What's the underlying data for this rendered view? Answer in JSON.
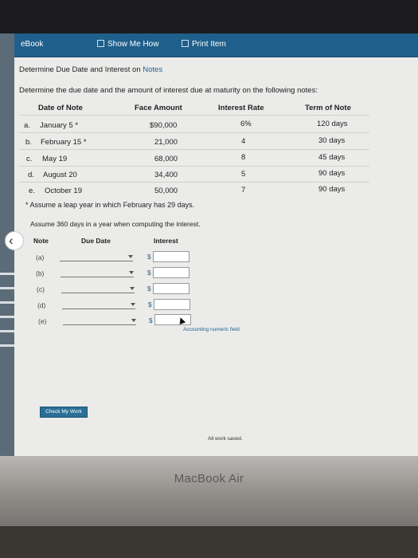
{
  "toolbar": {
    "ebook": "eBook",
    "show_me_how": "Show Me How",
    "print_item": "Print Item"
  },
  "title": {
    "prefix": "Determine Due Date and Interest on ",
    "link": "Notes"
  },
  "instruction": "Determine the due date and the amount of interest due at maturity on the following notes:",
  "notes_table": {
    "headers": [
      "Date of Note",
      "Face Amount",
      "Interest Rate",
      "Term of Note"
    ],
    "rows": [
      {
        "letter": "a.",
        "date": "January 5 *",
        "face": "$90,000",
        "rate": "6%",
        "term": "120 days"
      },
      {
        "letter": "b.",
        "date": "February 15 *",
        "face": "21,000",
        "rate": "4",
        "term": "30 days"
      },
      {
        "letter": "c.",
        "date": "May 19",
        "face": "68,000",
        "rate": "8",
        "term": "45 days"
      },
      {
        "letter": "d.",
        "date": "August 20",
        "face": "34,400",
        "rate": "5",
        "term": "90 days"
      },
      {
        "letter": "e.",
        "date": "October 19",
        "face": "50,000",
        "rate": "7",
        "term": "90 days"
      }
    ]
  },
  "footnote": "* Assume a leap year in which February has 29 days.",
  "assume_text": "Assume 360 days in a year when computing the interest.",
  "answer_table": {
    "headers": [
      "Note",
      "Due Date",
      "Interest"
    ],
    "rows": [
      {
        "label": "(a)",
        "currency": "$",
        "due_date": "",
        "interest": ""
      },
      {
        "label": "(b)",
        "currency": "$",
        "due_date": "",
        "interest": ""
      },
      {
        "label": "(c)",
        "currency": "$",
        "due_date": "",
        "interest": ""
      },
      {
        "label": "(d)",
        "currency": "$",
        "due_date": "",
        "interest": ""
      },
      {
        "label": "(e)",
        "currency": "$",
        "due_date": "",
        "interest": ""
      }
    ]
  },
  "tooltip": "Accounting numeric field",
  "check_button": "Check My Work",
  "status": "All work saved.",
  "device_label": "MacBook Air",
  "colors": {
    "toolbar": "#1f5f8b",
    "link": "#1f5f8b",
    "button": "#2a6f95"
  },
  "icons": {
    "back": "chevron-left-icon",
    "show_me_how": "video-icon",
    "print": "print-icon"
  }
}
